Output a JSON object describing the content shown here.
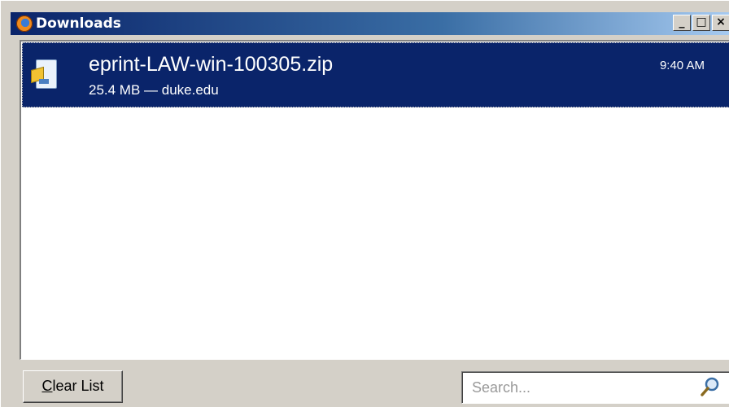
{
  "window": {
    "title": "Downloads",
    "buttons": {
      "minimize": "_",
      "maximize": "□",
      "close": "×"
    }
  },
  "downloads": [
    {
      "file_name": "eprint-LAW-win-100305.zip",
      "size_source": "25.4 MB — duke.edu",
      "time": "9:40 AM"
    }
  ],
  "footer": {
    "clear_prefix": "C",
    "clear_rest": "lear List",
    "search_placeholder": "Search..."
  },
  "colors": {
    "selection": "#0a246a",
    "titlebar_start": "#0a246a",
    "titlebar_end": "#a6caf0"
  }
}
